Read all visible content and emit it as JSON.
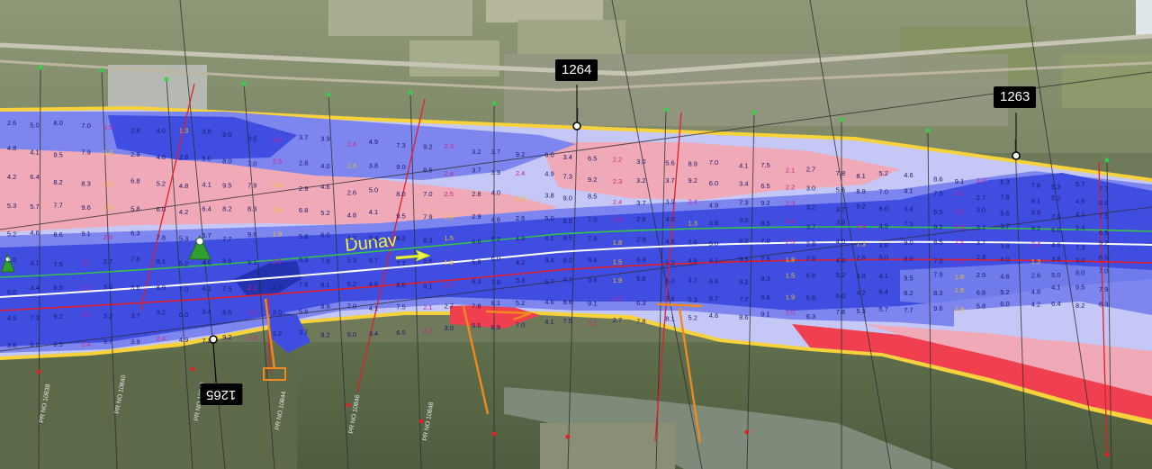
{
  "river": {
    "name": "Dunav",
    "label_color": "#e9f53a"
  },
  "km_markers": [
    {
      "label": "1264"
    },
    {
      "label": "1263"
    },
    {
      "label": "1265"
    }
  ],
  "profiles": [
    "PR NO 10838",
    "PR NO 10840",
    "PR NO 10842",
    "PR NO 10844",
    "PR NO 10846",
    "PR NO 10848"
  ],
  "colors": {
    "deep": "#3f4de0",
    "mid": "#7c86ee",
    "shallow": "#c5c8f7",
    "pink": "#f0a9b6",
    "red": "#f04050",
    "bank": "#f7d23a",
    "thalweg_green": "#34c24a",
    "fairway_red": "#e0202a",
    "axis_white": "#ffffff",
    "groyne": "#f08a1e"
  },
  "depth_labels": [
    "2.6",
    "4.8",
    "4.2",
    "5.3",
    "5.2",
    "7.0",
    "6.0",
    "4.9",
    "3.8",
    "5.0",
    "4.1",
    "6.4",
    "5.7",
    "4.6",
    "4.1",
    "3.4",
    "7.3",
    "9.0",
    "8.0",
    "9.5",
    "8.2",
    "7.7",
    "8.6",
    "7.5",
    "6.5",
    "9.2",
    "8.5",
    "7.0",
    "7.9",
    "8.3",
    "9.6",
    "9.1",
    "2.1",
    "2.2",
    "2.3",
    "2.4",
    "2.5",
    "1.8",
    "1.5",
    "1.9",
    "2.0",
    "2.7",
    "3.0",
    "3.2",
    "3.7",
    "2.8",
    "2.9",
    "6.8",
    "5.8",
    "6.3",
    "7.8",
    "5.6",
    "3.7",
    "3.9",
    "4.0",
    "4.6",
    "5.2",
    "6.0",
    "7.8",
    "8.1",
    "8.9",
    "9.2",
    "2.4",
    "1.3"
  ]
}
